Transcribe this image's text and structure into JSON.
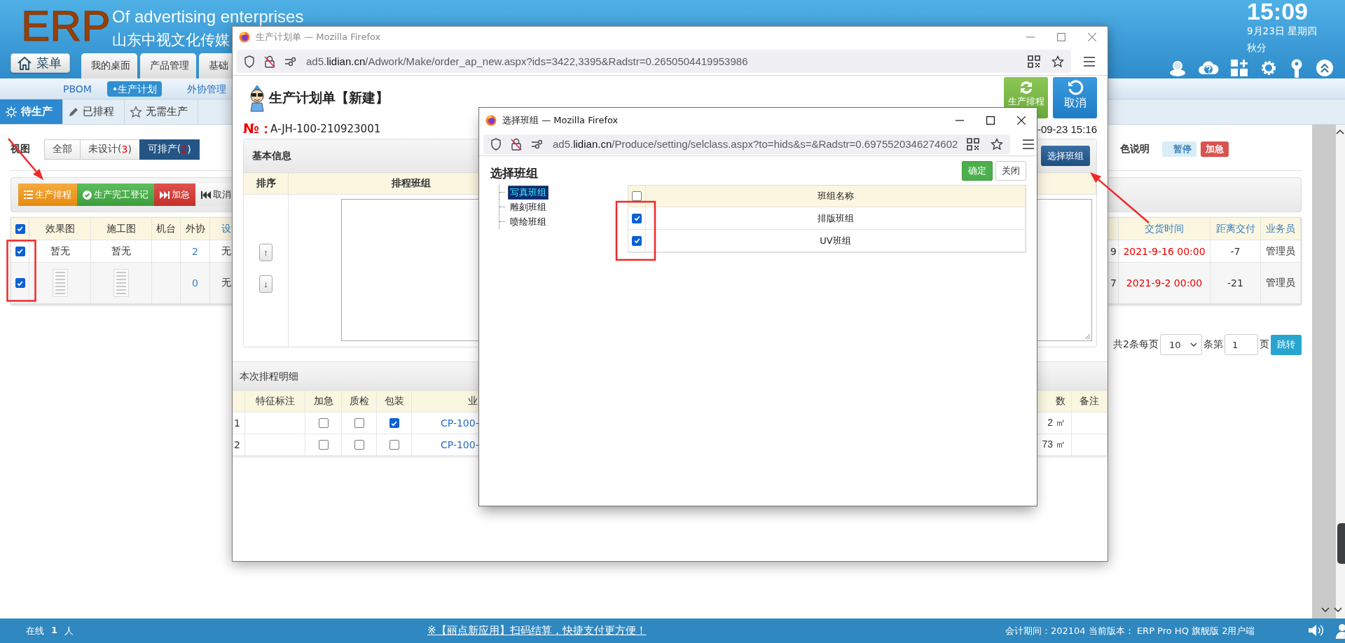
{
  "header": {
    "logo": "ERP",
    "title": "Of advertising enterprises",
    "company": "山东中视文化传媒",
    "menu_button": "菜单",
    "tabs": [
      {
        "label": "我的桌面",
        "selected": false
      },
      {
        "label": "产品管理",
        "selected": false
      },
      {
        "label": "基础",
        "selected": false
      }
    ],
    "clock": {
      "time": "15:09",
      "date": "9月23日 星期四",
      "term": "秋分"
    }
  },
  "sub_nav": [
    {
      "label": "PBOM",
      "selected": false
    },
    {
      "label": "•生产计划",
      "selected": true
    },
    {
      "label": "外协管理",
      "selected": false
    }
  ],
  "status_tabs": [
    {
      "label": "待生产",
      "selected": true
    },
    {
      "label": "已排程",
      "selected": false
    },
    {
      "label": "无需生产",
      "selected": false
    }
  ],
  "view_filter": {
    "label": "视图",
    "options": [
      {
        "label": "全部",
        "selected": false
      },
      {
        "label": "未设计(",
        "count": "3",
        "close": ")",
        "selected": false
      },
      {
        "label": "可排产(",
        "count": "2",
        "close": ")",
        "selected": true
      }
    ]
  },
  "color_legend": {
    "label": "色说明",
    "items": [
      {
        "label": "暂停",
        "color": "#d9edf7"
      },
      {
        "label": "加急",
        "color": "#d9534f"
      }
    ]
  },
  "toolbar": [
    {
      "label": "生产排程",
      "kind": "schedule"
    },
    {
      "label": "生产完工登记",
      "kind": "complete"
    },
    {
      "label": "加急",
      "kind": "urgent"
    },
    {
      "label": "取消",
      "kind": "cancel-urgent"
    }
  ],
  "orders_table": {
    "all_checked": true,
    "columns": [
      {
        "label": "效果图",
        "sortable": false
      },
      {
        "label": "施工图",
        "sortable": false
      },
      {
        "label": "机台",
        "sortable": false
      },
      {
        "label": "外协",
        "sortable": false
      },
      {
        "label": "设",
        "sortable": true
      },
      {
        "label": "交货时间",
        "sortable": true
      },
      {
        "label": "距离交付",
        "sortable": true
      },
      {
        "label": "业务员",
        "sortable": true
      }
    ],
    "rows": [
      {
        "selected": true,
        "effect_image": {
          "kind": "text",
          "text": "暂无"
        },
        "construction_image": {
          "kind": "text",
          "text": "暂无"
        },
        "outsourced": "2",
        "design": "无",
        "column_7": "9",
        "delivery_time": "2021-9-16 00:00",
        "overdue": true,
        "days_to_delivery": "-7",
        "salesperson": "管理员"
      },
      {
        "selected": true,
        "effect_image": {
          "kind": "thumbnail"
        },
        "construction_image": {
          "kind": "thumbnail"
        },
        "outsourced": "0",
        "design": "无",
        "column_7": "7",
        "delivery_time": "2021-9-2 00:00",
        "overdue": true,
        "days_to_delivery": "-21",
        "salesperson": "管理员"
      }
    ]
  },
  "pagination": {
    "total": "共2条每页",
    "page_size": "10",
    "unit": "条第",
    "page": "1",
    "page_unit": "页",
    "go_button": "跳转"
  },
  "status_bar": {
    "online_label": "在线",
    "online_count": "1",
    "online_unit": "人",
    "notice": "※【丽点新应用】扫码结算，快捷支付更方便！",
    "info": "会计期间：202104 当前版本： ERP Pro HQ 旗舰版 2用户端"
  },
  "plan_window": {
    "title": "生产计划单 — Mozilla Firefox",
    "active": false,
    "url": "ad5.**lidian.cn**/Adwork/Make/order_ap_new.aspx?ids=3422,3395&Radstr=0.2650504419953986",
    "heading": "生产计划单【新建】",
    "number_label": "№：",
    "number": "A-JH-100-210923001",
    "date": "-09-23 15:16",
    "buttons": [
      {
        "label": "生产排程",
        "kind": "refresh"
      },
      {
        "label": "取消",
        "kind": "undo"
      }
    ],
    "basic_info": {
      "title": "基本信息",
      "select_button": "选择班组",
      "columns": [
        "排序",
        "排程班组"
      ],
      "move_buttons": [
        "↑",
        "↓"
      ]
    },
    "details": {
      "title": "本次排程明细",
      "columns": [
        "特征标注",
        "加急",
        "质检",
        "包装",
        "业",
        "数",
        "备注"
      ],
      "rows": [
        {
          "index": "1",
          "urgent": false,
          "inspection": false,
          "packaging": true,
          "code": "CP-100-",
          "total": "2 ㎡"
        },
        {
          "index": "2",
          "urgent": false,
          "inspection": false,
          "packaging": false,
          "code": "CP-100-",
          "total": "73 ㎡"
        }
      ]
    }
  },
  "group_dialog": {
    "title": "选择班组 — Mozilla Firefox",
    "active": true,
    "url": "ad5.**lidian.cn**/Produce/setting/selclass.aspx?to=hids&s=&Radstr=0.6975520346274602",
    "heading": "选择班组",
    "buttons": [
      {
        "label": "确定",
        "kind": "confirm"
      },
      {
        "label": "关闭",
        "kind": "close"
      }
    ],
    "tree": [
      {
        "label": "写真班组",
        "selected": true
      },
      {
        "label": "雕刻班组",
        "selected": false
      },
      {
        "label": "喷绘班组",
        "selected": false
      }
    ],
    "table": {
      "all_checked": false,
      "column": "班组名称",
      "rows": [
        {
          "name": "排版班组",
          "checked": true
        },
        {
          "name": "UV班组",
          "checked": true
        }
      ]
    }
  }
}
